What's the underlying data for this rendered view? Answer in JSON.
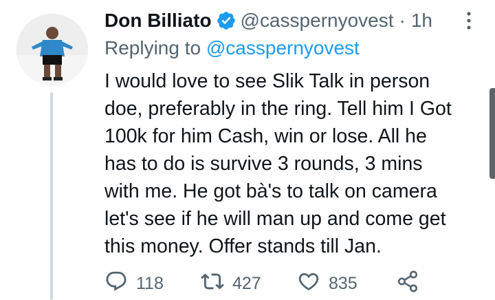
{
  "tweet": {
    "author_name": "Don Billiato",
    "handle": "@casspernyovest",
    "separator": "·",
    "time": "1h",
    "replying_prefix": "Replying to",
    "replying_to": "@casspernyovest",
    "text_lines": [
      "I would love to see Slik Talk in person",
      "doe, preferably in the ring. Tell him I Got",
      "100k for him Cash, win or lose. All he",
      "has to do is survive 3 rounds, 3 mins",
      "with me. He got bà's to talk on camera",
      "let's see if he will man up and come get",
      "this money. Offer stands till Jan."
    ]
  },
  "actions": {
    "reply_count": "118",
    "retweet_count": "427",
    "like_count": "835"
  },
  "icons": {
    "verified": "verified-badge-icon",
    "more": "more-vertical-icon",
    "reply": "reply-icon",
    "retweet": "retweet-icon",
    "like": "heart-icon",
    "share": "share-icon"
  },
  "colors": {
    "text": "#0f1419",
    "secondary": "#536471",
    "accent": "#1d9bf0",
    "thread_line": "#cfd9de"
  }
}
